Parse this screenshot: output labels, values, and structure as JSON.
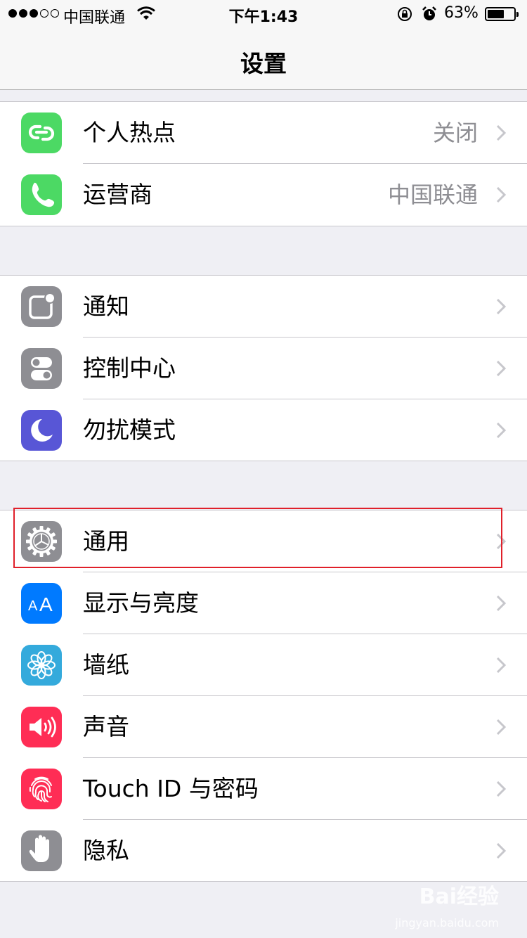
{
  "status_bar": {
    "carrier": "中国联通",
    "time": "下午1:43",
    "battery_percent_text": "63%",
    "battery_level": 0.63,
    "signal_bars_filled": 3,
    "signal_bars_total": 5
  },
  "nav": {
    "title": "设置"
  },
  "groups": [
    {
      "rows": [
        {
          "label": "个人热点",
          "value": "关闭",
          "icon": "personal-hotspot-icon",
          "color": "#4cd964"
        },
        {
          "label": "运营商",
          "value": "中国联通",
          "icon": "phone-icon",
          "color": "#4cd964"
        }
      ]
    },
    {
      "rows": [
        {
          "label": "通知",
          "icon": "notifications-icon",
          "color": "#8e8e93"
        },
        {
          "label": "控制中心",
          "icon": "control-center-icon",
          "color": "#8e8e93"
        },
        {
          "label": "勿扰模式",
          "icon": "moon-icon",
          "color": "#5856d6"
        }
      ]
    },
    {
      "rows": [
        {
          "label": "通用",
          "icon": "gear-icon",
          "color": "#8e8e93"
        },
        {
          "label": "显示与亮度",
          "icon": "text-size-icon",
          "color": "#007aff"
        },
        {
          "label": "墙纸",
          "icon": "wallpaper-flower-icon",
          "color": "#34aadc"
        },
        {
          "label": "声音",
          "icon": "speaker-icon",
          "color": "#ff2d55"
        },
        {
          "label": "Touch ID 与密码",
          "icon": "fingerprint-icon",
          "color": "#ff2d55"
        },
        {
          "label": "隐私",
          "icon": "hand-icon",
          "color": "#8e8e93"
        }
      ]
    }
  ],
  "watermark": {
    "text": "Bai经验",
    "sub": "jingyan.baidu.com"
  },
  "highlight_color": "#e0202a"
}
